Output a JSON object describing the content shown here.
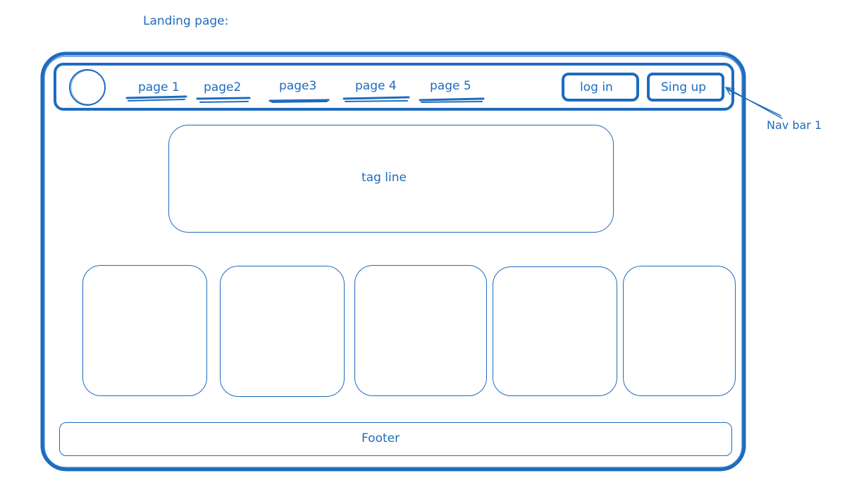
{
  "title": "Landing page:",
  "nav": {
    "items": [
      {
        "label": "page 1"
      },
      {
        "label": "page2"
      },
      {
        "label": "page3"
      },
      {
        "label": "page 4"
      },
      {
        "label": "page 5"
      }
    ],
    "login_label": "log in",
    "signup_label": "Sing up"
  },
  "annotation": "Nav bar 1",
  "hero": {
    "tagline": "tag line"
  },
  "cards": [
    {},
    {},
    {},
    {},
    {}
  ],
  "footer": {
    "label": "Footer"
  },
  "colors": {
    "stroke": "#1e6bbf",
    "background": "#ffffff"
  }
}
